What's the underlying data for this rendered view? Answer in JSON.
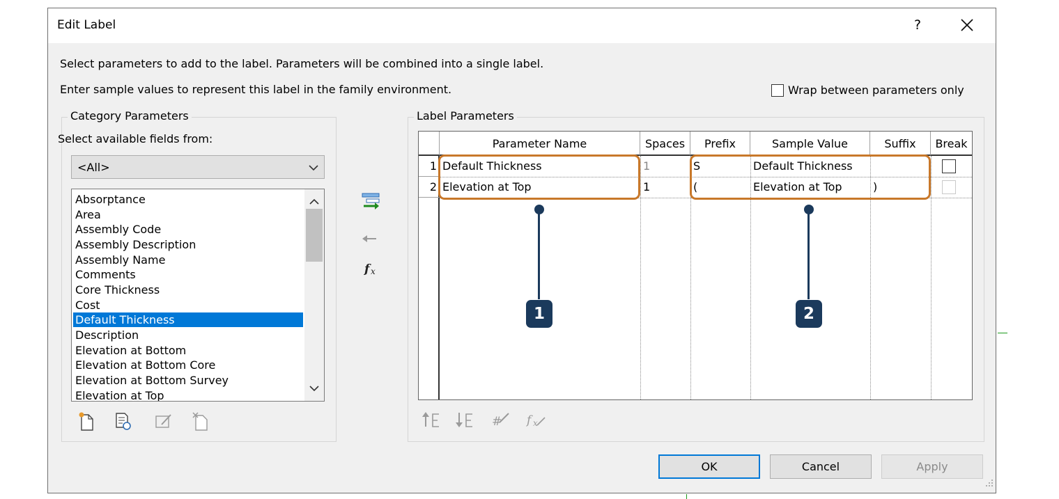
{
  "dialog": {
    "title": "Edit Label",
    "help_label": "?",
    "instruction_1": "Select parameters to add to the label.  Parameters will be combined into a single label.",
    "instruction_2": "Enter sample values to represent this label in the family environment.",
    "wrap_label": "Wrap between parameters only",
    "wrap_checked": false
  },
  "category": {
    "title": "Category Parameters",
    "select_label": "Select available fields from:",
    "dropdown_value": "<All>",
    "items": [
      "Absorptance",
      "Area",
      "Assembly Code",
      "Assembly Description",
      "Assembly Name",
      "Comments",
      "Core Thickness",
      "Cost",
      "Default Thickness",
      "Description",
      "Elevation at Bottom",
      "Elevation at Bottom Core",
      "Elevation at Bottom Survey",
      "Elevation at Top"
    ],
    "selected": "Default Thickness"
  },
  "label_params": {
    "title": "Label Parameters",
    "columns": [
      "Parameter Name",
      "Spaces",
      "Prefix",
      "Sample Value",
      "Suffix",
      "Break"
    ],
    "rows": [
      {
        "num": "1",
        "name": "Default Thickness",
        "spaces": "1",
        "prefix": "S",
        "sample": "Default Thickness",
        "suffix": "",
        "break": false
      },
      {
        "num": "2",
        "name": "Elevation at Top",
        "spaces": "1",
        "prefix": "(",
        "sample": "Elevation at Top",
        "suffix": ")",
        "break": false
      }
    ]
  },
  "callouts": [
    "1",
    "2"
  ],
  "buttons": {
    "ok": "OK",
    "cancel": "Cancel",
    "apply": "Apply"
  },
  "colors": {
    "callout_outline": "#c8782a",
    "callout_marker": "#1b3a5c",
    "selection": "#0078d7"
  }
}
